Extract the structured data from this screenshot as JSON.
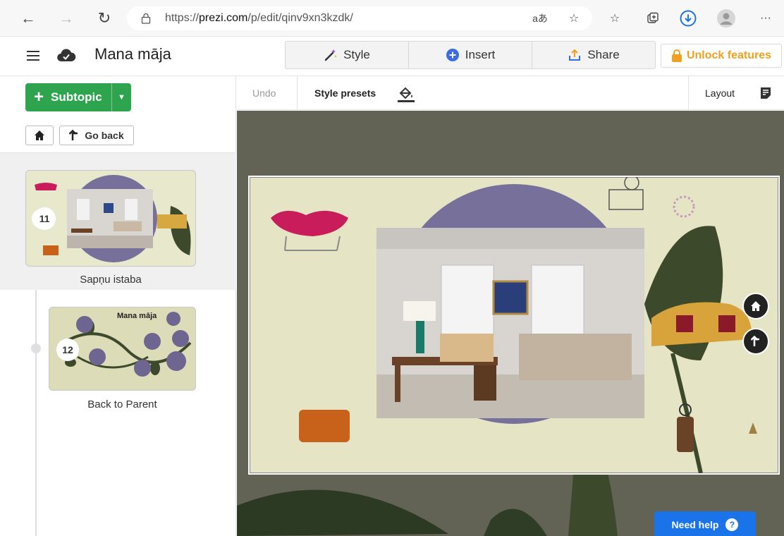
{
  "browser": {
    "url_prefix": "https://",
    "url_domain": "prezi.com",
    "url_path": "/p/edit/qinv9xn3kzdk/",
    "read_aloud_label": "aあ",
    "more_label": "···"
  },
  "header": {
    "title": "Mana māja",
    "tabs": [
      {
        "label": "Style",
        "icon": "magic-wand-icon"
      },
      {
        "label": "Insert",
        "icon": "plus-circle-icon"
      },
      {
        "label": "Share",
        "icon": "upload-icon"
      }
    ],
    "unlock_label": "Unlock features"
  },
  "sidebar": {
    "subtopic_label": "Subtopic",
    "goback_label": "Go back",
    "items": [
      {
        "number": "11",
        "caption": "Sapņu istaba",
        "active": true
      },
      {
        "number": "12",
        "caption": "Back to Parent",
        "active": false,
        "thumb_title": "Mana māja"
      }
    ]
  },
  "subtoolbar": {
    "undo_label": "Undo",
    "presets_label": "Style presets",
    "layout_label": "Layout"
  },
  "help": {
    "label": "Need help",
    "icon_glyph": "?"
  },
  "colors": {
    "accent_green": "#2ea44f",
    "help_blue": "#1a73e8",
    "unlock_orange": "#f0a020",
    "canvas_bg": "#636355",
    "slide_bg": "#e5e4c5",
    "circle_purple": "#77709a",
    "leaf_green": "#3c4a2b"
  }
}
